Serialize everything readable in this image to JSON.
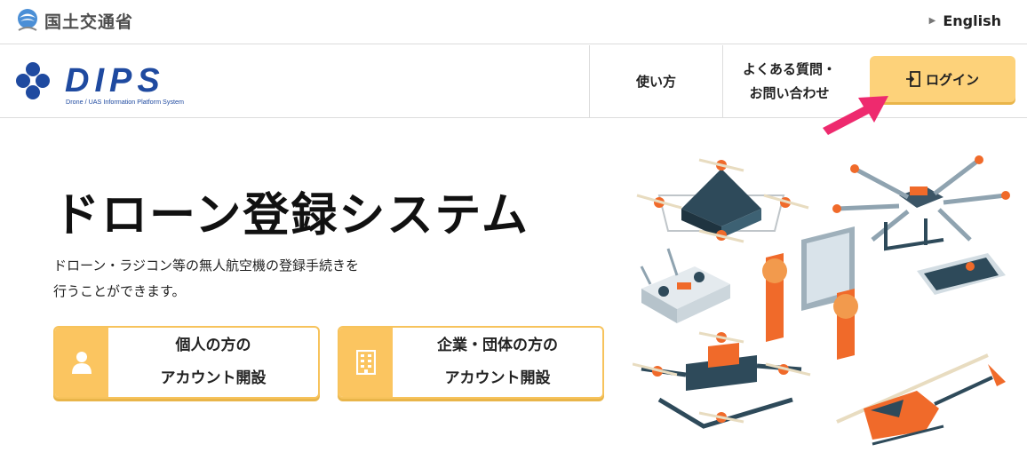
{
  "topbar": {
    "ministry_name": "国土交通省",
    "ministry_icon": "mlit-logo",
    "language_link": "English"
  },
  "header": {
    "logo_text": "DIPS",
    "logo_subtitle": "Drone / UAS Information Platform System",
    "nav": {
      "how_to_use": "使い方",
      "faq_line1": "よくある質問・",
      "faq_line2": "お問い合わせ"
    },
    "login_label": "ログイン",
    "login_icon": "login-door-icon"
  },
  "hero": {
    "title": "ドローン登録システム",
    "description_line1": "ドローン・ラジコン等の無人航空機の登録手続きを",
    "description_line2": "行うことができます。"
  },
  "accounts": {
    "personal_line1": "個人の方の",
    "personal_line2": "アカウント開設",
    "personal_icon": "person-icon",
    "corporate_line1": "企業・団体の方の",
    "corporate_line2": "アカウント開設",
    "corporate_icon": "building-icon"
  },
  "colors": {
    "accent_yellow": "#fdd27a",
    "accent_yellow_dark": "#fbc560",
    "arrow_pink": "#ee2a6e",
    "logo_blue": "#1f4aa0",
    "drone_dark": "#2e4a5a",
    "drone_orange": "#f06a2a"
  }
}
